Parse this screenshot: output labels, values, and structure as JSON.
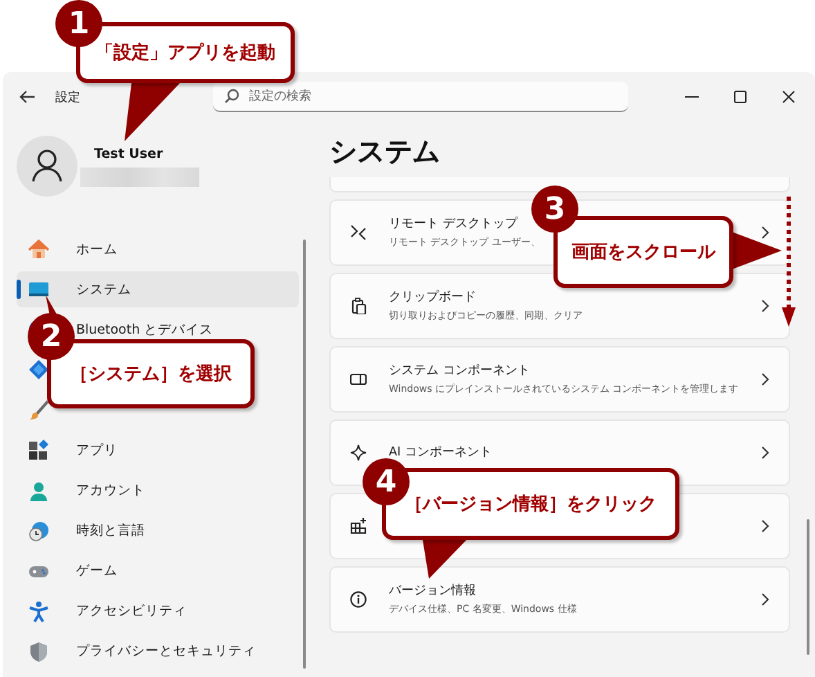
{
  "window": {
    "title": "設定",
    "search": {
      "placeholder": "設定の検索"
    }
  },
  "profile": {
    "name": "Test User"
  },
  "sidebar": {
    "items": [
      {
        "label": "ホーム",
        "selected": false
      },
      {
        "label": "システム",
        "selected": true
      },
      {
        "label": "Bluetooth とデバイス",
        "selected": false
      },
      {
        "selected": false
      },
      {
        "selected": false
      },
      {
        "label": "アプリ",
        "selected": false
      },
      {
        "label": "アカウント",
        "selected": false
      },
      {
        "label": "時刻と言語",
        "selected": false
      },
      {
        "label": "ゲーム",
        "selected": false
      },
      {
        "label": "アクセシビリティ",
        "selected": false
      },
      {
        "label": "プライバシーとセキュリティ",
        "selected": false
      }
    ]
  },
  "main": {
    "heading": "システム",
    "cards": [
      {
        "kind": "setting",
        "title": "リモート デスクトップ",
        "subtitle": "リモート デスクトップ ユーザー、"
      },
      {
        "kind": "setting",
        "title": "クリップボード",
        "subtitle": "切り取りおよびコピーの履歴、同期、クリア"
      },
      {
        "kind": "setting",
        "title": "システム コンポーネント",
        "subtitle": "Windows にプレインストールされているシステム コンポーネントを管理します"
      },
      {
        "kind": "setting",
        "title": "AI コンポーネント"
      },
      {
        "kind": "setting"
      },
      {
        "kind": "setting",
        "title": "バージョン情報",
        "subtitle": "デバイス仕様、PC 名変更、Windows 仕様"
      }
    ]
  },
  "callouts": [
    {
      "number": "1",
      "text": "「設定」アプリを起動"
    },
    {
      "number": "2",
      "text": "［システム］を選択"
    },
    {
      "number": "3",
      "text": "画面をスクロール"
    },
    {
      "number": "4",
      "text": "［バージョン情報］をクリック"
    }
  ]
}
